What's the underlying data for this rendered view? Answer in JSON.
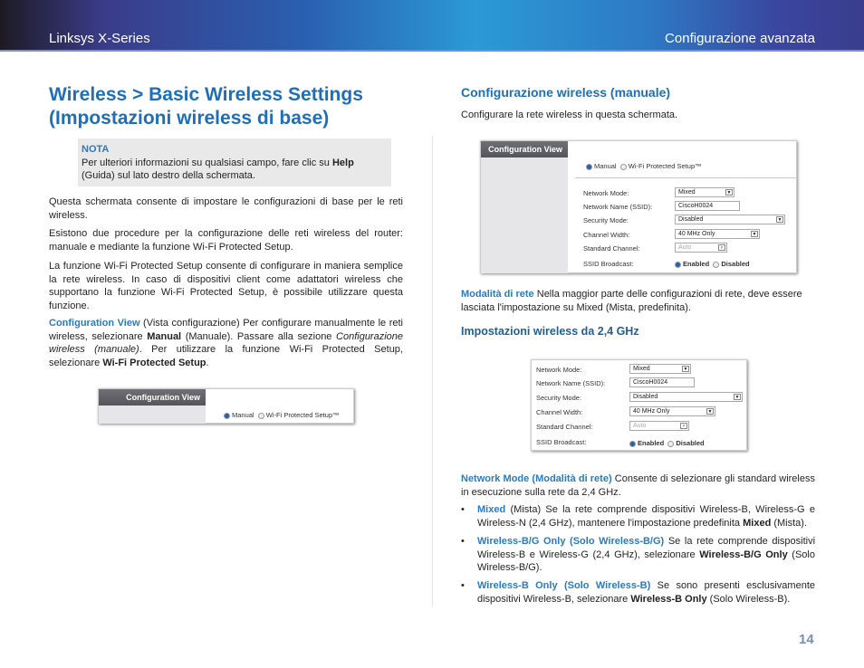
{
  "header": {
    "left": "Linksys X-Series",
    "right": "Configurazione avanzata"
  },
  "left": {
    "title": "Wireless > Basic Wireless Settings (Impostazioni wireless di base)",
    "note": {
      "label": "NOTA",
      "text_a": "Per ulteriori informazioni su qualsiasi campo, fare clic su ",
      "bold": "Help",
      "text_b": " (Guida) sul lato destro della schermata."
    },
    "p1": "Questa schermata consente di impostare le configurazioni di base per le reti wireless.",
    "p2": "Esistono due procedure per la configurazione delle reti wireless del router: manuale e mediante la funzione Wi-Fi Protected Setup.",
    "p3": "La funzione Wi-Fi Protected Setup consente di configurare in maniera semplice la rete wireless. In caso di dispositivi client come adattatori wireless che supportano la funzione Wi-Fi Protected Setup, è possibile utilizzare questa funzione.",
    "p4": {
      "term": "Configuration View",
      "a": " (Vista configurazione)  Per configurare manualmente le reti wireless, selezionare ",
      "b1": "Manual",
      "c": " (Manuale). Passare alla sezione ",
      "i1": "Configurazione wireless (manuale)",
      "d": ". Per utilizzare la funzione Wi-Fi Protected Setup, selezionare ",
      "b2": "Wi-Fi Protected Setup",
      "e": "."
    },
    "shot": {
      "side": "Configuration View",
      "manual": "Manual",
      "wps": "Wi-Fi Protected Setup™"
    }
  },
  "right": {
    "title": "Configurazione wireless (manuale)",
    "intro": "Configurare la rete wireless in questa schermata.",
    "shot1": {
      "side": "Configuration View",
      "manual": "Manual",
      "wps": "Wi-Fi Protected Setup™"
    },
    "form": {
      "mode_label": "Network Mode:",
      "mode": "Mixed",
      "ssid_label": "Network Name (SSID):",
      "ssid": "CiscoH0024",
      "sec_label": "Security Mode:",
      "sec": "Disabled",
      "width_label": "Channel Width:",
      "width": "40 MHz Only",
      "chan_label": "Standard Channel:",
      "chan": "Auto",
      "bc_label": "SSID Broadcast:",
      "enabled": "Enabled",
      "disabled": "Disabled"
    },
    "p_mode": {
      "term": "Modalità di rete",
      "text": "  Nella maggior parte delle configurazioni di rete, deve essere lasciata l'impostazione su Mixed (Mista, predefinita)."
    },
    "subtitle": "Impostazioni wireless da 2,4 GHz",
    "p_nm": {
      "term": "Network Mode (Modalità di rete)",
      "text": " Consente di selezionare gli standard wireless in esecuzione sulla rete da 2,4 GHz."
    },
    "bullets": [
      {
        "term": "Mixed",
        "a": " (Mista) Se la rete comprende dispositivi Wireless-B, Wireless-G e Wireless-N (2,4 GHz), mantenere l'impostazione predefinita ",
        "b": "Mixed",
        "c": " (Mista)."
      },
      {
        "term": "Wireless-B/G Only (Solo Wireless-B/G)",
        "a": " Se la rete comprende dispositivi Wireless-B e Wireless-G (2,4 GHz), selezionare ",
        "b": "Wireless-B/G Only",
        "c": " (Solo Wireless-B/G)."
      },
      {
        "term": "Wireless-B Only (Solo Wireless-B)",
        "a": " Se sono presenti esclusivamente dispositivi Wireless-B, selezionare ",
        "b": "Wireless-B Only",
        "c": " (Solo Wireless-B)."
      }
    ]
  },
  "page_number": "14"
}
